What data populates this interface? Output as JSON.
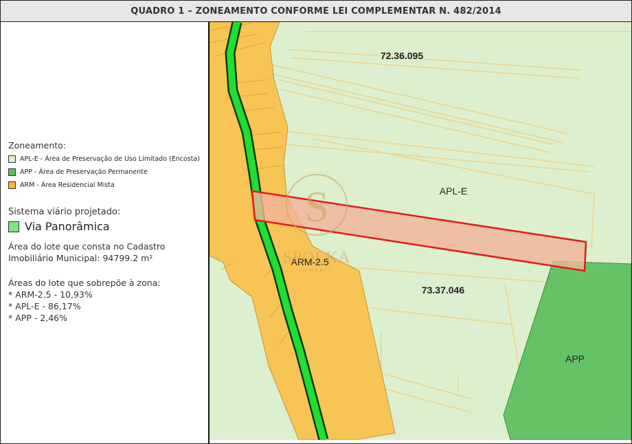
{
  "header": {
    "title": "QUADRO 1 – ZONEAMENTO CONFORME LEI COMPLEMENTAR N. 482/2014"
  },
  "legend": {
    "heading": "Zoneamento:",
    "items": [
      {
        "label": "APL-E - Área de Preservação de Uso Limitado (Encosta)",
        "color": "#dcefcf"
      },
      {
        "label": "APP - Área de Preservação Permanente",
        "color": "#5fbf5f"
      },
      {
        "label": "ARM - Área Residencial Mista",
        "color": "#f5b541"
      }
    ],
    "road_heading": "Sistema viário projetado:",
    "road_item": {
      "label": "Via Panorâmica",
      "color": "#7ee87e"
    },
    "lot_area": {
      "line1": "Área do lote que consta no Cadastro",
      "line2": "Imobiliário Municipal: 94799.2 m²"
    },
    "overlap": {
      "heading": "Áreas do lote que sobrepõe à zona:",
      "lines": [
        "* ARM-2.5 - 10,93%",
        "* APL-E - 86,17%",
        "* APP - 2,46%"
      ]
    }
  },
  "map": {
    "labels": {
      "parcel_north": "72.36.095",
      "zone_aple": "APL-E",
      "zone_arm": "ARM-2.5",
      "parcel_south": "73.37.046",
      "zone_app": "APP"
    },
    "watermark": {
      "letter": "S",
      "text": "SPOLKA",
      "sub": "IMÓVEIS"
    },
    "colors": {
      "aple": "#dcefcf",
      "app": "#66c266",
      "arm": "#f8c455",
      "road": "#22dd33",
      "lot_outline": "#e11a1a",
      "lot_fill": "#f0b49a"
    }
  }
}
